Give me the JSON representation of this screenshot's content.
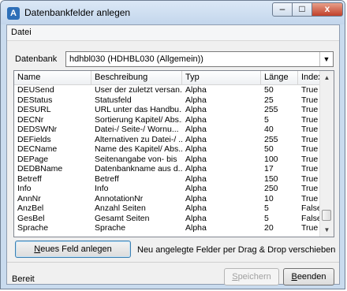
{
  "window": {
    "title": "Datenbankfelder anlegen",
    "min": "–",
    "max": "□",
    "close": "x",
    "icon": "A"
  },
  "menu": {
    "datei": "Datei"
  },
  "db": {
    "label": "Datenbank",
    "value": "hdhbl030 (HDHBL030 (Allgemein))"
  },
  "grid": {
    "headers": [
      "Name",
      "Beschreibung",
      "Typ",
      "Länge",
      "Index..."
    ],
    "rows": [
      [
        "DEUSend",
        "User der zuletzt versan...",
        "Alpha",
        "50",
        "True"
      ],
      [
        "DEStatus",
        "Statusfeld",
        "Alpha",
        "25",
        "True"
      ],
      [
        "DESURL",
        "URL unter das Handbu...",
        "Alpha",
        "255",
        "True"
      ],
      [
        "DECNr",
        "Sortierung Kapitel/ Abs...",
        "Alpha",
        "5",
        "True"
      ],
      [
        "DEDSWNr",
        "Datei-/ Seite-/ Wornu...",
        "Alpha",
        "40",
        "True"
      ],
      [
        "DEFields",
        "Alternativen zu Datei-/ ...",
        "Alpha",
        "255",
        "True"
      ],
      [
        "DECName",
        "Name des Kapitel/ Abs...",
        "Alpha",
        "50",
        "True"
      ],
      [
        "DEPage",
        "Seitenangabe von- bis",
        "Alpha",
        "100",
        "True"
      ],
      [
        "DEDBName",
        "Datenbankname aus d...",
        "Alpha",
        "17",
        "True"
      ],
      [
        "Betreff",
        "Betreff",
        "Alpha",
        "150",
        "True"
      ],
      [
        "Info",
        "Info",
        "Alpha",
        "250",
        "True"
      ],
      [
        "AnnNr",
        "AnnotationNr",
        "Alpha",
        "10",
        "True"
      ],
      [
        "AnzBel",
        "Anzahl Seiten",
        "Alpha",
        "5",
        "False"
      ],
      [
        "GesBel",
        "Gesamt Seiten",
        "Alpha",
        "5",
        "False"
      ],
      [
        "Sprache",
        "Sprache",
        "Alpha",
        "20",
        "True"
      ]
    ]
  },
  "buttons": {
    "new_pre": "N",
    "new_rest": "eues Feld anlegen",
    "save_pre": "S",
    "save_rest": "peichern",
    "end_pre": "B",
    "end_rest": "eenden"
  },
  "hint": "Neu angelegte Felder per Drag & Drop verschieben",
  "status": "Bereit"
}
